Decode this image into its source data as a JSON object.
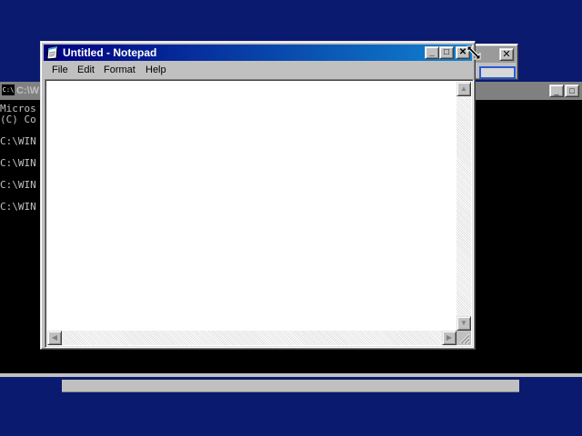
{
  "background_window": {
    "close_glyph": "✕"
  },
  "console": {
    "title": "C:\\W",
    "icon_text": "C:\\",
    "buttons": {
      "minimize": "_",
      "maximize": "□"
    },
    "lines": [
      "Micros",
      "(C) Co",
      "",
      "C:\\WIN",
      "",
      "C:\\WIN",
      "",
      "C:\\WIN",
      "",
      "C:\\WIN"
    ]
  },
  "notepad": {
    "title": "Untitled - Notepad",
    "buttons": {
      "minimize": "_",
      "maximize": "□",
      "close": "✕"
    },
    "menu": [
      "File",
      "Edit",
      "Format",
      "Help"
    ],
    "content": "",
    "icons": {
      "app": "notepad-icon"
    }
  },
  "colors": {
    "desktop": "#0a1a6e",
    "active_title_start": "#000080",
    "active_title_end": "#1084d0",
    "window_face": "#c0c0c0"
  }
}
